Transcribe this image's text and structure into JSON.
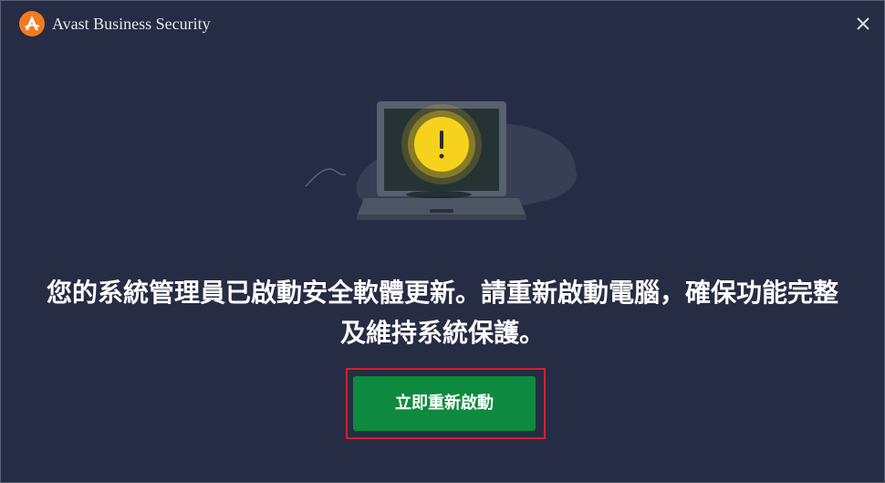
{
  "window": {
    "title": "Avast Business Security",
    "logo_icon": "avast-logo-icon",
    "close_icon": "close-icon"
  },
  "illustration": {
    "icon": "laptop-warning-icon",
    "warning_symbol": "!"
  },
  "message": {
    "line1": "您的系統管理員已啟動安全軟體更新。請重新啟動電腦，確保功能完整",
    "line2": "及維持系統保護。"
  },
  "actions": {
    "restart_label": "立即重新啟動"
  },
  "colors": {
    "background": "#262c43",
    "accent_orange": "#f47a20",
    "button_green": "#0d8a3f",
    "warning_yellow": "#f7d21c",
    "highlight_red": "#d0212b"
  }
}
